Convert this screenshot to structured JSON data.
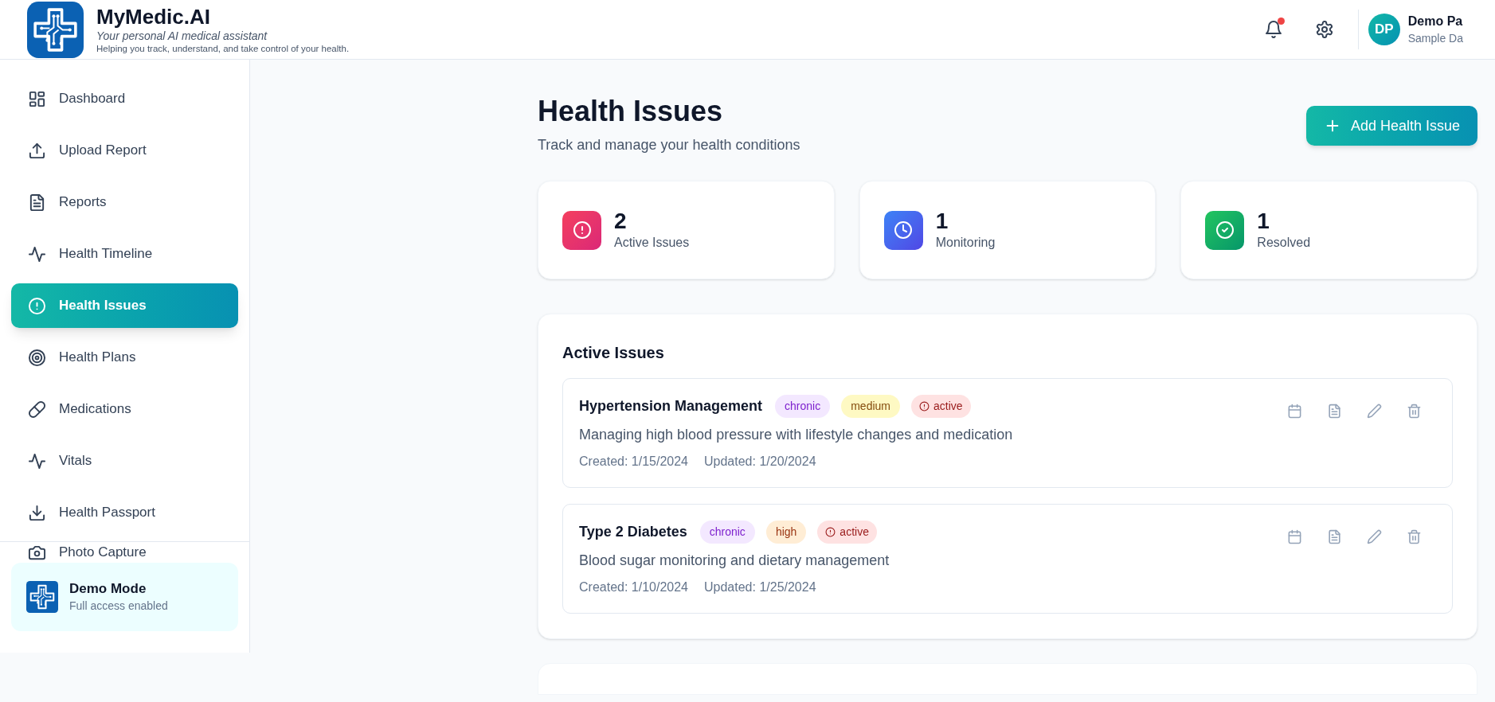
{
  "app": {
    "name": "MyMedic.AI",
    "tagline": "Your personal AI medical assistant",
    "description": "Helping you track, understand, and take control of your health."
  },
  "header": {
    "notifications_unread": true,
    "user": {
      "initials": "DP",
      "name": "Demo Pa",
      "subtitle": "Sample Da"
    }
  },
  "sidebar": {
    "items": [
      {
        "label": "Dashboard",
        "kind": "dashboard",
        "selected": false
      },
      {
        "label": "Upload Report",
        "kind": "upload",
        "selected": false
      },
      {
        "label": "Reports",
        "kind": "reports",
        "selected": false
      },
      {
        "label": "Health Timeline",
        "kind": "timeline",
        "selected": false
      },
      {
        "label": "Health Issues",
        "kind": "issues",
        "selected": true
      },
      {
        "label": "Health Plans",
        "kind": "plans",
        "selected": false
      },
      {
        "label": "Medications",
        "kind": "medications",
        "selected": false
      },
      {
        "label": "Vitals",
        "kind": "vitals",
        "selected": false
      },
      {
        "label": "Health Passport",
        "kind": "passport",
        "selected": false
      }
    ],
    "partial_item": {
      "label": "Photo Capture",
      "kind": "photo"
    },
    "demo": {
      "title": "Demo Mode",
      "subtitle": "Full access enabled"
    }
  },
  "page": {
    "title": "Health Issues",
    "subtitle": "Track and manage your health conditions",
    "add_button": "Add Health Issue"
  },
  "stats": [
    {
      "value": "2",
      "label": "Active Issues",
      "kind": "active"
    },
    {
      "value": "1",
      "label": "Monitoring",
      "kind": "monitoring"
    },
    {
      "value": "1",
      "label": "Resolved",
      "kind": "resolved"
    }
  ],
  "active_section": {
    "title": "Active Issues",
    "issues": [
      {
        "title": "Hypertension Management",
        "type": "chronic",
        "severity": "medium",
        "status": "active",
        "description": "Managing high blood pressure with lifestyle changes and medication",
        "created": "Created: 1/15/2024",
        "updated": "Updated: 1/20/2024"
      },
      {
        "title": "Type 2 Diabetes",
        "type": "chronic",
        "severity": "high",
        "status": "active",
        "description": "Blood sugar monitoring and dietary management",
        "created": "Created: 1/10/2024",
        "updated": "Updated: 1/25/2024"
      }
    ]
  }
}
